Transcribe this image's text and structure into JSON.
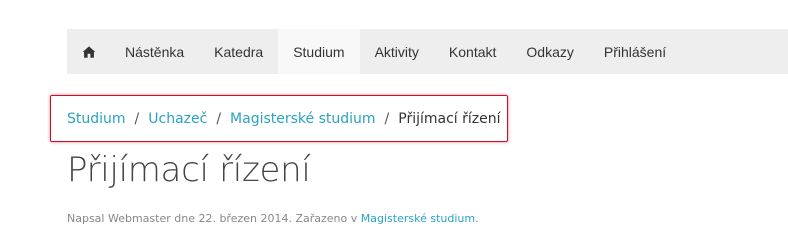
{
  "nav": {
    "home_icon": "home-icon",
    "items": [
      {
        "label": "Nástěnka"
      },
      {
        "label": "Katedra"
      },
      {
        "label": "Studium"
      },
      {
        "label": "Aktivity"
      },
      {
        "label": "Kontakt"
      },
      {
        "label": "Odkazy"
      },
      {
        "label": "Přihlášení"
      }
    ],
    "active": "Studium"
  },
  "breadcrumb": {
    "items": [
      "Studium",
      "Uchazeč",
      "Magisterské studium"
    ],
    "separator": "/",
    "current": "Přijímací řízení"
  },
  "page": {
    "title": "Přijímací řízení"
  },
  "meta": {
    "prefix": "Napsal Webmaster dne 22. březen 2014. Zařazeno v ",
    "category": "Magisterské studium",
    "suffix": "."
  },
  "colors": {
    "link": "#2aa3c4",
    "nav_bg": "#eeeeee",
    "highlight_border": "#c8102e"
  }
}
